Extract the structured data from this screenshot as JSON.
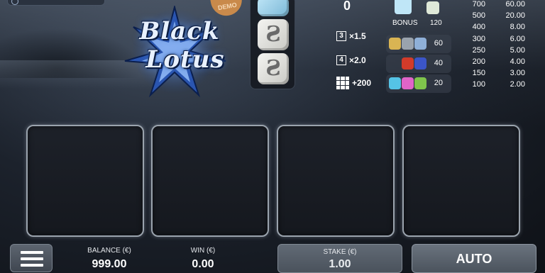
{
  "logo": {
    "line1": "Black",
    "line2": "Lotus"
  },
  "demo_badge": "DEMO",
  "dice_column": {
    "die_symbol": "Ƨ"
  },
  "spin_count": "0",
  "multipliers": [
    {
      "symbol": "3",
      "value": "×1.5"
    },
    {
      "symbol": "4",
      "value": "×2.0"
    },
    {
      "symbol": "grid",
      "value": "+200"
    }
  ],
  "bonus": {
    "label": "BONUS",
    "value": "120"
  },
  "combos": [
    {
      "value": "60",
      "colors": [
        "#d9b453",
        "#9aa3ad",
        "#8fb0d8"
      ]
    },
    {
      "value": "40",
      "colors": [
        "#d23b2a",
        "#3b55c7"
      ]
    },
    {
      "value": "20",
      "colors": [
        "#55c3e6",
        "#e064c8",
        "#7fc44c"
      ]
    }
  ],
  "paytable": [
    {
      "count": "700",
      "payout": "60.00"
    },
    {
      "count": "500",
      "payout": "20.00"
    },
    {
      "count": "400",
      "payout": "8.00"
    },
    {
      "count": "300",
      "payout": "6.00"
    },
    {
      "count": "250",
      "payout": "5.00"
    },
    {
      "count": "200",
      "payout": "4.00"
    },
    {
      "count": "150",
      "payout": "3.00"
    },
    {
      "count": "100",
      "payout": "2.00"
    }
  ],
  "bottom_bar": {
    "balance_label": "BALANCE (€)",
    "balance_value": "999.00",
    "win_label": "WIN (€)",
    "win_value": "0.00",
    "stake_label": "STAKE (€)",
    "stake_value": "1.00",
    "auto_label": "AUTO"
  },
  "colors": {
    "accent": "#4a7cd0",
    "reel_border": "#9aa3ad"
  }
}
